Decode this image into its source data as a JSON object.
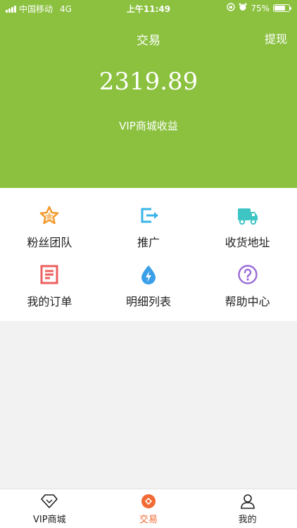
{
  "status_bar": {
    "carrier": "中国移动",
    "network": "4G",
    "time": "上午11:49",
    "battery": "75%",
    "battery_level": 0.75
  },
  "header": {
    "title": "交易",
    "withdraw_label": "提现",
    "amount": "2319.89",
    "amount_label": "VIP商城收益",
    "bg_color": "#8bc13f"
  },
  "menu": [
    {
      "label": "粉丝团队",
      "icon": "star-icon",
      "color": "#f39a2f"
    },
    {
      "label": "推广",
      "icon": "share-export-icon",
      "color": "#3ab4e8"
    },
    {
      "label": "收货地址",
      "icon": "truck-icon",
      "color": "#3fc4c4"
    },
    {
      "label": "我的订单",
      "icon": "order-list-icon",
      "color": "#ec5f5f"
    },
    {
      "label": "明细列表",
      "icon": "water-drop-icon",
      "color": "#3a9fe8"
    },
    {
      "label": "帮助中心",
      "icon": "question-icon",
      "color": "#9b6bd6"
    }
  ],
  "tabbar": [
    {
      "label": "VIP商城",
      "icon": "diamond-icon",
      "active": false
    },
    {
      "label": "交易",
      "icon": "trade-icon",
      "active": true
    },
    {
      "label": "我的",
      "icon": "user-icon",
      "active": false
    }
  ],
  "accent_color": "#f26a34"
}
